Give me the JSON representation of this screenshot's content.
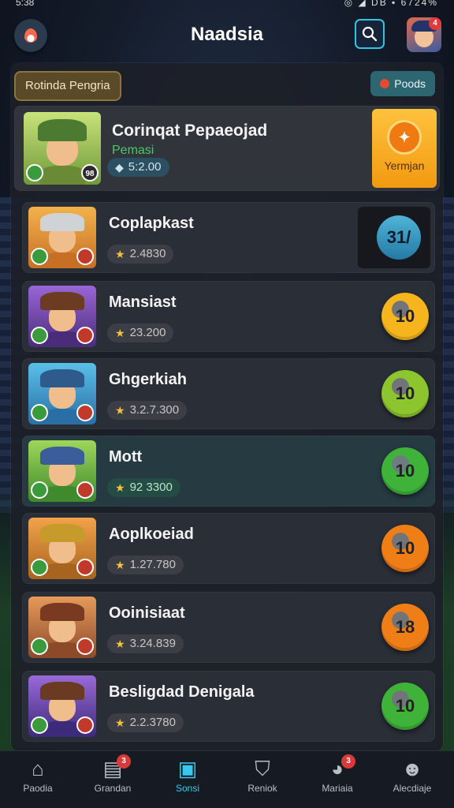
{
  "status": {
    "time": "5:38",
    "right": "◎ ◢ DB ▪ 6724%"
  },
  "header": {
    "title": "Naadsia"
  },
  "panel": {
    "tag": "Rotinda Pengria",
    "pill": "Poods"
  },
  "first": {
    "name": "Corinqat Pepaeojad",
    "subname": "Pemasi",
    "score": "5:2.00",
    "lvl_right": "98",
    "claim_label": "Yermjan"
  },
  "rows": [
    {
      "name": "Coplapkast",
      "score": "2.4830",
      "coin": "31/",
      "style": "dark"
    },
    {
      "name": "Mansiast",
      "score": "23.200",
      "coin": "10",
      "style": "yellow"
    },
    {
      "name": "Ghgerkiah",
      "score": "3.2.7.300",
      "coin": "10",
      "style": "lime"
    },
    {
      "name": "Mott",
      "score": "92 3300",
      "coin": "10",
      "style": "green"
    },
    {
      "name": "Aoplkoeiad",
      "score": "1.27.780",
      "coin": "10",
      "style": "orange"
    },
    {
      "name": "Ooinisiaat",
      "score": "3.24.839",
      "coin": "18",
      "style": "orange"
    },
    {
      "name": "Besligdad Denigala",
      "score": "2.2.3780",
      "coin": "10",
      "style": "green"
    }
  ],
  "nav": [
    {
      "label": "Paodia",
      "icon": "home-icon"
    },
    {
      "label": "Grandan",
      "icon": "news-icon",
      "badge": "3"
    },
    {
      "label": "Sonsi",
      "icon": "cards-icon",
      "active": true
    },
    {
      "label": "Reniok",
      "icon": "shield-icon"
    },
    {
      "label": "Mariaia",
      "icon": "chat-icon",
      "badge": "3"
    },
    {
      "label": "Alecdiaje",
      "icon": "profile-icon"
    }
  ],
  "colors": {
    "accent": "#37c9f0",
    "claim": "#f5a623",
    "coin_yellow": "#f6b51c",
    "coin_lime": "#8cc52d",
    "coin_green": "#3fb23a",
    "coin_orange": "#f07e17"
  }
}
